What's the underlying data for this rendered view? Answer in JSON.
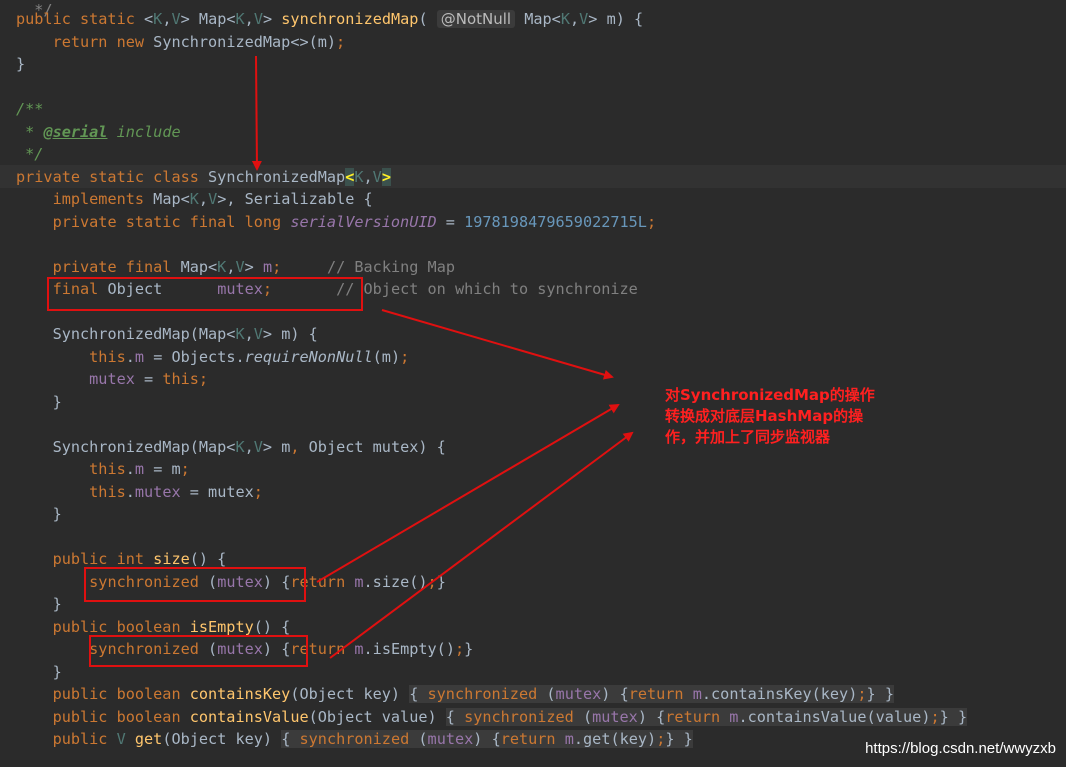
{
  "editor": {
    "line_sm_1": "public static ",
    "line_sm_2": "<",
    "line_sm_K": "K",
    "line_sm_comma": ",",
    "line_sm_V": "V",
    "line_sm_3": "> Map<",
    "line_sm_4": "> ",
    "line_sm_name": "synchronizedMap",
    "line_sm_paren": "(",
    "annotation": "@NotNull",
    "line_sm_5": " Map<",
    "line_sm_6": "> m) {",
    "return_kw": "return new ",
    "return_rest": "SynchronizedMap<>(m)",
    "semicolon": ";",
    "close_brace": "}",
    "doc_open": "/**",
    "doc_star": " * ",
    "doc_tag": "@serial",
    "doc_text": " include",
    "doc_close": " */",
    "class_kw": "private static class ",
    "class_name": "SynchronizedMap",
    "lt": "<",
    "gt": ">",
    "implements_kw": "implements ",
    "implements_rest_1": "Map<",
    "implements_rest_2": ">, Serializable {",
    "svuid_kw": "private static final long ",
    "svuid_name": "serialVersionUID",
    "svuid_eq": " = ",
    "svuid_val": "1978198479659022715L",
    "m_kw": "private final ",
    "m_type_1": "Map<",
    "m_type_2": "> ",
    "m_name": "m",
    "m_comment": "// Backing Map",
    "mutex_kw": "final ",
    "mutex_type": "Object      ",
    "mutex_name": "mutex",
    "mutex_comment": "// Object on which to synchronize",
    "ctor1_1": "SynchronizedMap(Map<",
    "ctor1_2": "> m) {",
    "this_kw": "this",
    "dot": ".",
    "m_field": "m",
    "eq": " = ",
    "objects": "Objects.",
    "require": "requireNonNull",
    "m_arg": "(m)",
    "mutex_field": "mutex",
    "ctor2_2": "> m",
    "comma_sp": ", ",
    "ctor2_3": "Object mutex) {",
    "m_plain": "m",
    "mutex_plain": "mutex",
    "public_int": "public int ",
    "size": "size",
    "size_rest": "() {",
    "sync_kw": "synchronized ",
    "open_paren": "(",
    "close_paren_sp": ") ",
    "brace_open": "{",
    "return_plain": "return ",
    "size_call": ".size()",
    "brace_close": "}",
    "public_boolean": "public boolean ",
    "isEmpty": "isEmpty",
    "isEmpty_rest": "() {",
    "isEmpty_call": ".isEmpty()",
    "containsKey": "containsKey",
    "containsKey_args": "(Object key) ",
    "containsKey_call": ".containsKey(key)",
    "containsValue": "containsValue",
    "containsValue_args": "(Object value) ",
    "containsValue_call": ".containsValue(value)",
    "public_kw": "public ",
    "V_type": "V ",
    "get": "get",
    "get_args": "(Object key) ",
    "get_call": ".get(key)",
    "sp": " "
  },
  "annotation_note": "对SynchronizedMap的操作\n转换成对底层HashMap的操\n作，并加上了同步监视器",
  "watermark": "https://blog.csdn.net/wwyzxb",
  "colors": {
    "arrow": "#e01010",
    "note": "#ff2020"
  }
}
